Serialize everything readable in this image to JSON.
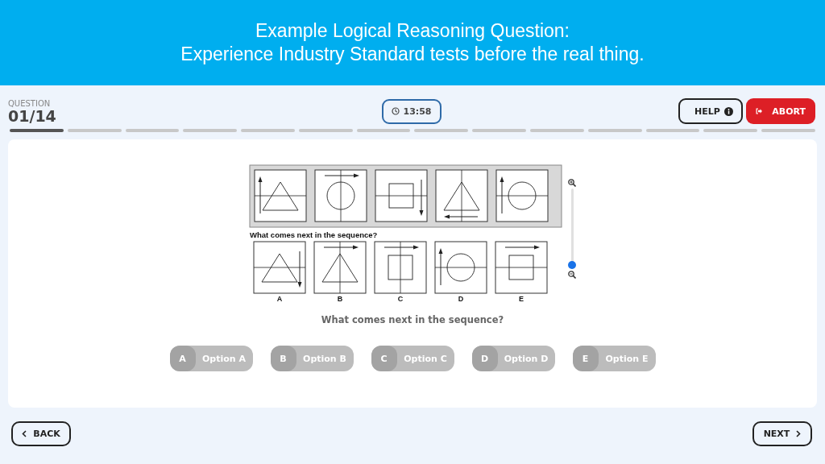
{
  "banner": {
    "lines": [
      "Example Logical Reasoning Question:",
      "Experience Industry Standard tests before the real thing."
    ]
  },
  "header": {
    "label": "QUESTION",
    "counter": "01/14",
    "timer": "13:58",
    "help": "HELP",
    "abort": "ABORT"
  },
  "progress": [
    {
      "current": true
    },
    {
      "current": false
    },
    {
      "current": false
    },
    {
      "current": false
    },
    {
      "current": false
    },
    {
      "current": false
    },
    {
      "current": false
    },
    {
      "current": false
    },
    {
      "current": false
    },
    {
      "current": false
    },
    {
      "current": false
    },
    {
      "current": false
    },
    {
      "current": false
    },
    {
      "current": false
    }
  ],
  "figure": {
    "prompt": "What comes next in the sequence?",
    "options": [
      {
        "label": "A"
      },
      {
        "label": "B"
      },
      {
        "label": "C"
      },
      {
        "label": "D"
      },
      {
        "label": "E"
      }
    ],
    "zoom": {
      "level": 0
    }
  },
  "question": "What comes next in the sequence?",
  "answers": [
    {
      "letter": "A",
      "text": "Option A",
      "selected": false
    },
    {
      "letter": "B",
      "text": "Option B",
      "selected": false
    },
    {
      "letter": "C",
      "text": "Option C",
      "selected": false
    },
    {
      "letter": "D",
      "text": "Option D",
      "selected": false
    },
    {
      "letter": "E",
      "text": "Option E",
      "selected": false
    }
  ],
  "footer": {
    "back": "BACK",
    "next": "NEXT"
  }
}
